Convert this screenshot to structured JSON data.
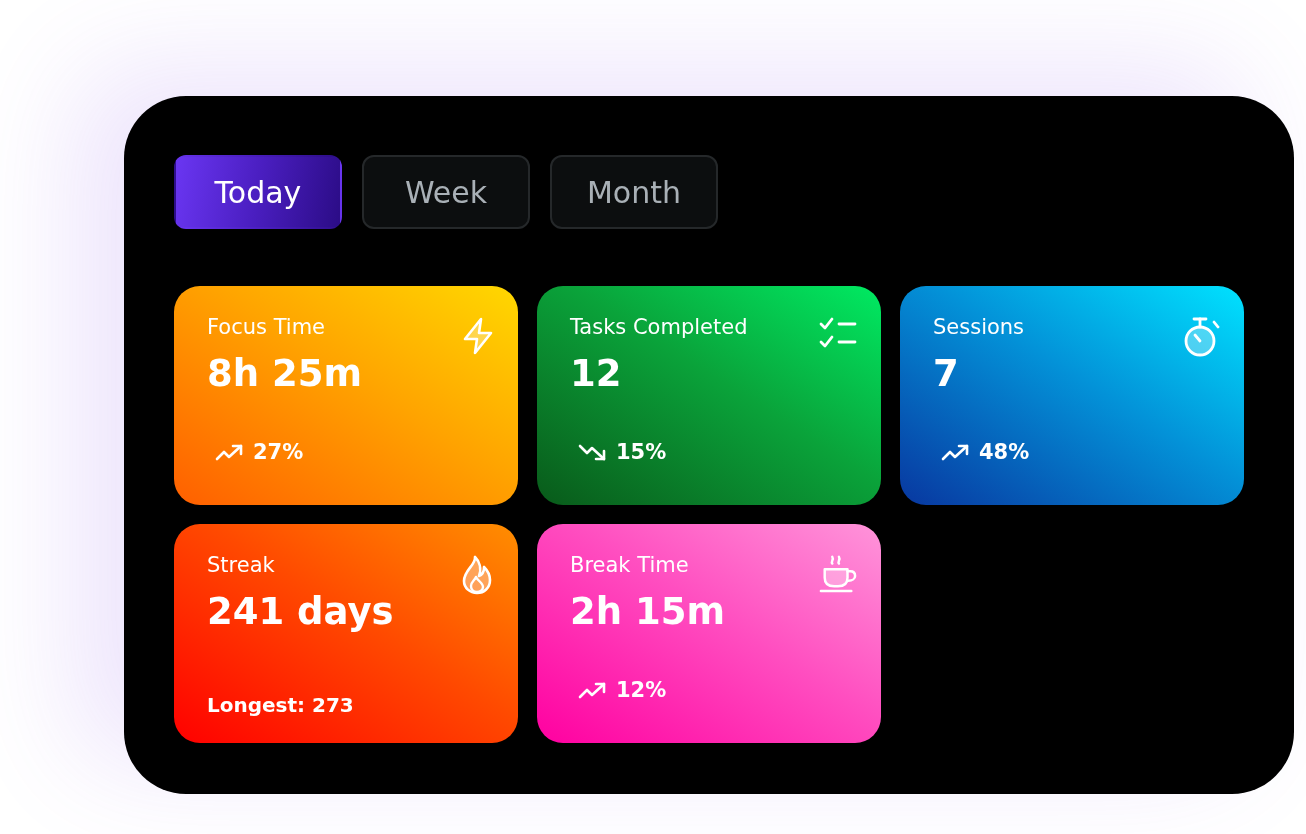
{
  "tabs": [
    {
      "label": "Today",
      "selected": true
    },
    {
      "label": "Week",
      "selected": false
    },
    {
      "label": "Month",
      "selected": false
    }
  ],
  "cards": [
    {
      "kind": "trend",
      "label": "Focus Time",
      "value": "8h 25m",
      "change": "27%",
      "rising": true
    },
    {
      "kind": "trend",
      "label": "Tasks Completed",
      "value": "12",
      "change": "15%",
      "rising": false
    },
    {
      "kind": "trend",
      "label": "Sessions",
      "value": "7",
      "change": "48%",
      "rising": true
    },
    {
      "kind": "note",
      "label": "Streak",
      "value": "241 days",
      "note": "Longest: 273"
    },
    {
      "kind": "trend",
      "label": "Break Time",
      "value": "2h 15m",
      "change": "12%",
      "rising": true
    }
  ]
}
